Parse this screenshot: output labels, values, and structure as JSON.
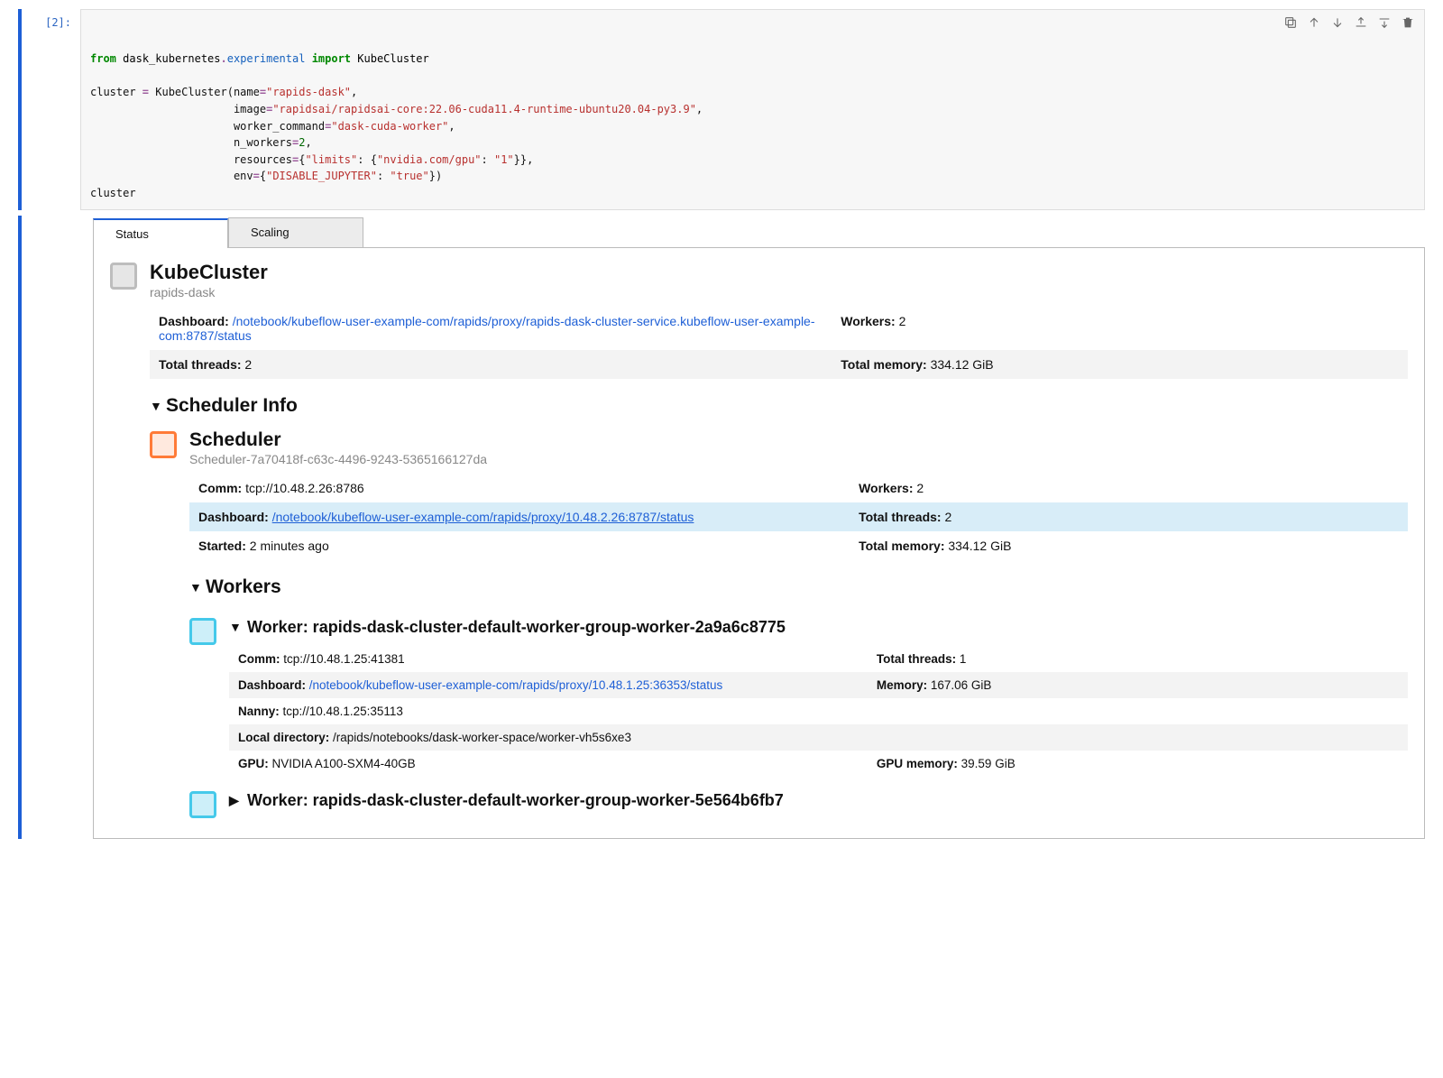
{
  "cell": {
    "prompt": "[2]:",
    "code": {
      "kw_from": "from",
      "mod1": "dask_kubernetes",
      "dot1": ".",
      "mod2": "experimental",
      "kw_import": "import",
      "cls": "KubeCluster",
      "l2a": "cluster ",
      "op1": "=",
      "l2b": " KubeCluster(name",
      "op2": "=",
      "s_name": "\"rapids-dask\"",
      "c1": ",",
      "pad": "                      ",
      "arg_image": "image",
      "s_image": "\"rapidsai/rapidsai-core:22.06-cuda11.4-runtime-ubuntu20.04-py3.9\"",
      "arg_wc": "worker_command",
      "s_wc": "\"dask-cuda-worker\"",
      "arg_nw": "n_workers",
      "n_nw": "2",
      "arg_res": "resources",
      "op_eq": "=",
      "brace_o": "{",
      "s_limits": "\"limits\"",
      "colon": ": ",
      "s_gpu": "\"nvidia.com/gpu\"",
      "s_one": "\"1\"",
      "brace_c": "}",
      "arg_env": "env",
      "s_dj": "\"DISABLE_JUPYTER\"",
      "s_true": "\"true\"",
      "paren_c": ")",
      "l_last": "cluster"
    }
  },
  "tabs": {
    "status": "Status",
    "scaling": "Scaling"
  },
  "kube": {
    "title": "KubeCluster",
    "subtitle": "rapids-dask",
    "dashboard_label": "Dashboard:",
    "dashboard_url": "/notebook/kubeflow-user-example-com/rapids/proxy/rapids-dask-cluster-service.kubeflow-user-example-com:8787/status",
    "workers_label": "Workers:",
    "workers": "2",
    "threads_label": "Total threads:",
    "threads": "2",
    "mem_label": "Total memory:",
    "mem": "334.12 GiB"
  },
  "sched_section": "Scheduler Info",
  "sched": {
    "title": "Scheduler",
    "subtitle": "Scheduler-7a70418f-c63c-4496-9243-5365166127da",
    "comm_label": "Comm:",
    "comm": "tcp://10.48.2.26:8786",
    "workers_label": "Workers:",
    "workers": "2",
    "dashboard_label": "Dashboard:",
    "dashboard_url": "/notebook/kubeflow-user-example-com/rapids/proxy/10.48.2.26:8787/status",
    "threads_label": "Total threads:",
    "threads": "2",
    "started_label": "Started:",
    "started": "2 minutes ago",
    "mem_label": "Total memory:",
    "mem": "334.12 GiB"
  },
  "workers_section": "Workers",
  "w1": {
    "title": "Worker: rapids-dask-cluster-default-worker-group-worker-2a9a6c8775",
    "comm_label": "Comm:",
    "comm": "tcp://10.48.1.25:41381",
    "threads_label": "Total threads:",
    "threads": "1",
    "dashboard_label": "Dashboard:",
    "dashboard_url": "/notebook/kubeflow-user-example-com/rapids/proxy/10.48.1.25:36353/status",
    "mem_label": "Memory:",
    "mem": "167.06 GiB",
    "nanny_label": "Nanny:",
    "nanny": "tcp://10.48.1.25:35113",
    "dir_label": "Local directory:",
    "dir": "/rapids/notebooks/dask-worker-space/worker-vh5s6xe3",
    "gpu_label": "GPU:",
    "gpu": "NVIDIA A100-SXM4-40GB",
    "gpumem_label": "GPU memory:",
    "gpumem": "39.59 GiB"
  },
  "w2": {
    "title": "Worker: rapids-dask-cluster-default-worker-group-worker-5e564b6fb7"
  }
}
